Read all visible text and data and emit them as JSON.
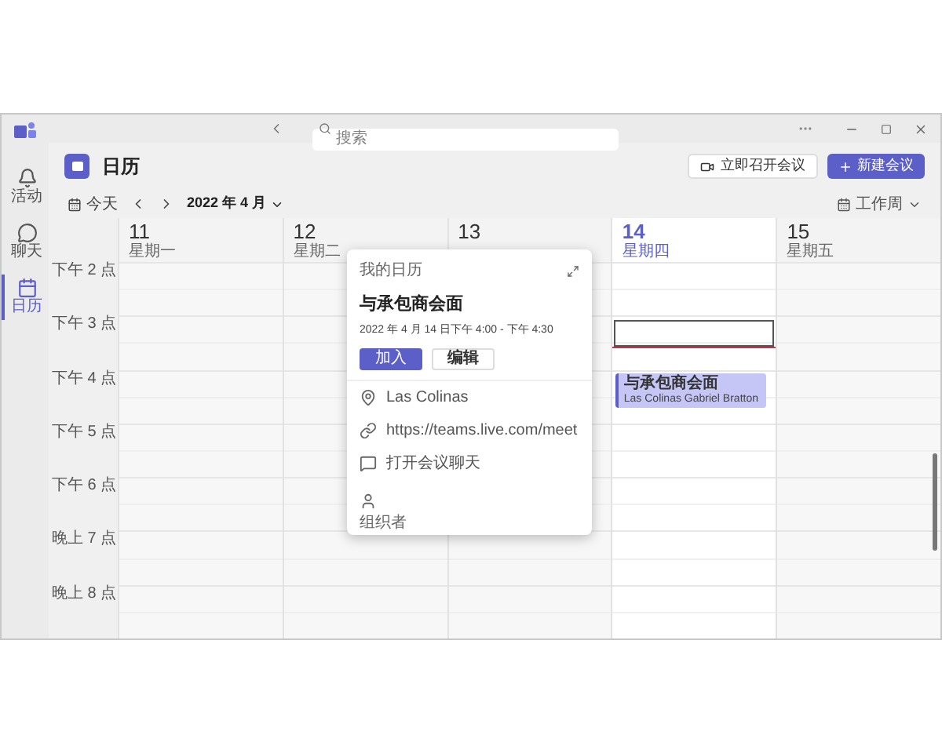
{
  "rail": [
    {
      "label": "活动",
      "kind": "bell",
      "selected": false
    },
    {
      "label": "聊天",
      "kind": "chat",
      "selected": false
    },
    {
      "label": "日历",
      "kind": "calendar",
      "selected": true
    }
  ],
  "search": {
    "placeholder": "搜索"
  },
  "header": {
    "title": "日历",
    "meet_now": "立即召开会议",
    "new_meeting": "新建会议"
  },
  "toolbar": {
    "today": "今天",
    "month": "2022 年 4 月",
    "view": "工作周"
  },
  "days": [
    {
      "date": "11",
      "weekday": "星期一",
      "today": false
    },
    {
      "date": "12",
      "weekday": "星期二",
      "today": false
    },
    {
      "date": "13",
      "today": false
    },
    {
      "date": "14",
      "weekday": "星期四",
      "today": true,
      "events": [
        {
          "title": "与承包商会面",
          "subtitle": "Las Colinas Gabriel Bratton"
        }
      ]
    },
    {
      "date": "15",
      "weekday": "星期五",
      "today": false
    }
  ],
  "times": [
    "下午 2 点",
    "下午 3 点",
    "下午 4 点",
    "下午 5 点",
    "下午 6 点",
    "晚上 7 点",
    "晚上 8 点"
  ],
  "popup": {
    "calendar": "我的日历",
    "title": "与承包商会面",
    "time": "2022 年 4 月 14 日下午 4:00 - 下午 4:30",
    "join": "加入",
    "edit": "编辑",
    "rows": [
      {
        "kind": "location",
        "text": "Las Colinas"
      },
      {
        "kind": "link",
        "text": "https://teams.live.com/meet"
      },
      {
        "kind": "chat",
        "text": "打开会议聊天"
      },
      {
        "kind": "organizer",
        "text": "组织者"
      }
    ]
  }
}
